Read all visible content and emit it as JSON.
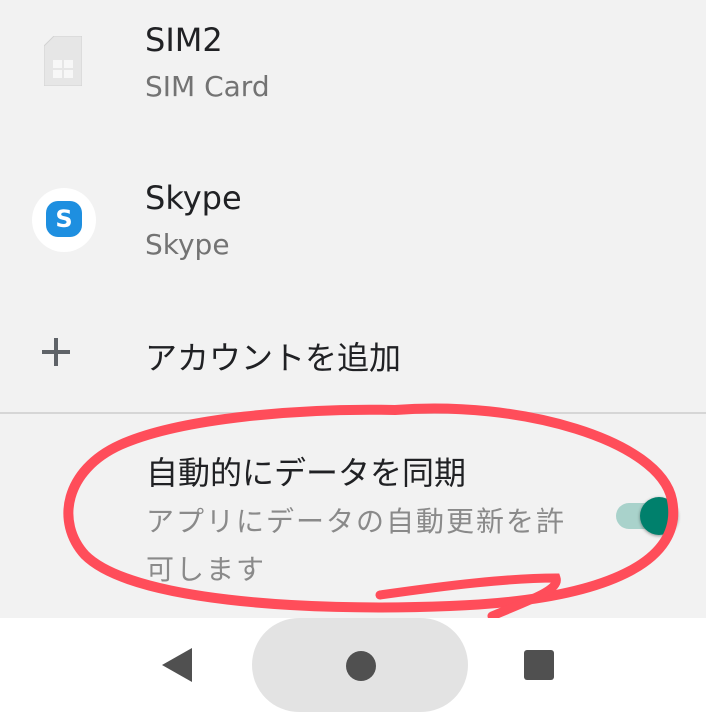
{
  "accounts": [
    {
      "title": "SIM2",
      "subtitle": "SIM Card",
      "icon": "sim-card-icon"
    },
    {
      "title": "Skype",
      "subtitle": "Skype",
      "icon": "skype-icon",
      "icon_letter": "S",
      "icon_color": "#1e8fe0"
    }
  ],
  "add_account": {
    "label": "アカウントを追加",
    "icon": "plus-icon"
  },
  "auto_sync": {
    "title": "自動的にデータを同期",
    "description": "アプリにデータの自動更新を許可します",
    "enabled": true,
    "accent_color": "#00806c"
  },
  "annotation": {
    "color": "#ff4d5a",
    "shape": "hand-drawn-ellipse"
  },
  "navbar": {
    "back": "back-icon",
    "home": "home-icon",
    "recents": "recents-icon"
  }
}
